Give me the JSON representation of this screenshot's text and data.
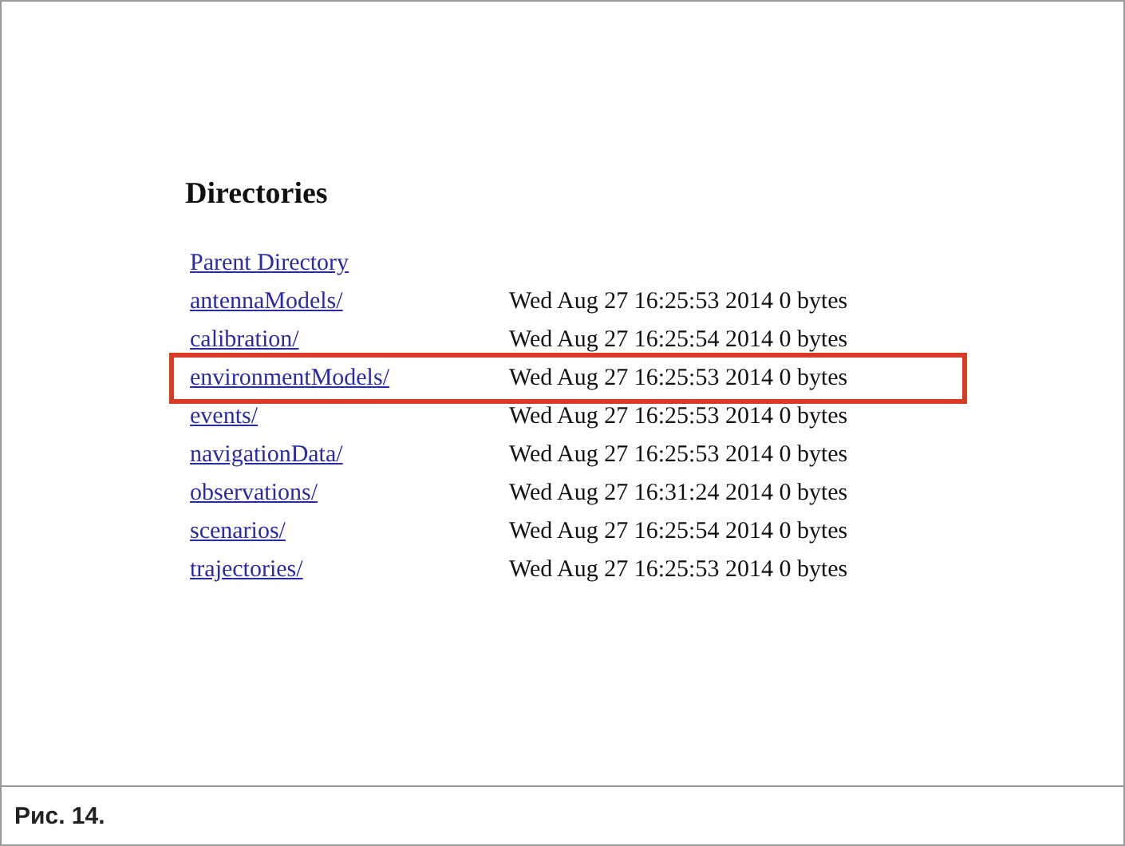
{
  "listing": {
    "heading": "Directories",
    "rows": [
      {
        "name": "Parent Directory",
        "modified": "",
        "highlighted": false
      },
      {
        "name": "antennaModels/",
        "modified": "Wed Aug 27 16:25:53 2014 0 bytes",
        "highlighted": false
      },
      {
        "name": "calibration/",
        "modified": "Wed Aug 27 16:25:54 2014 0 bytes",
        "highlighted": false
      },
      {
        "name": "environmentModels/",
        "modified": "Wed Aug 27 16:25:53 2014 0 bytes",
        "highlighted": true
      },
      {
        "name": "events/",
        "modified": "Wed Aug 27 16:25:53 2014 0 bytes",
        "highlighted": false
      },
      {
        "name": "navigationData/",
        "modified": "Wed Aug 27 16:25:53 2014 0 bytes",
        "highlighted": false
      },
      {
        "name": "observations/",
        "modified": "Wed Aug 27 16:31:24 2014 0 bytes",
        "highlighted": false
      },
      {
        "name": "scenarios/",
        "modified": "Wed Aug 27 16:25:54 2014 0 bytes",
        "highlighted": false
      },
      {
        "name": "trajectories/",
        "modified": "Wed Aug 27 16:25:53 2014 0 bytes",
        "highlighted": false
      }
    ]
  },
  "caption": "Рис. 14."
}
